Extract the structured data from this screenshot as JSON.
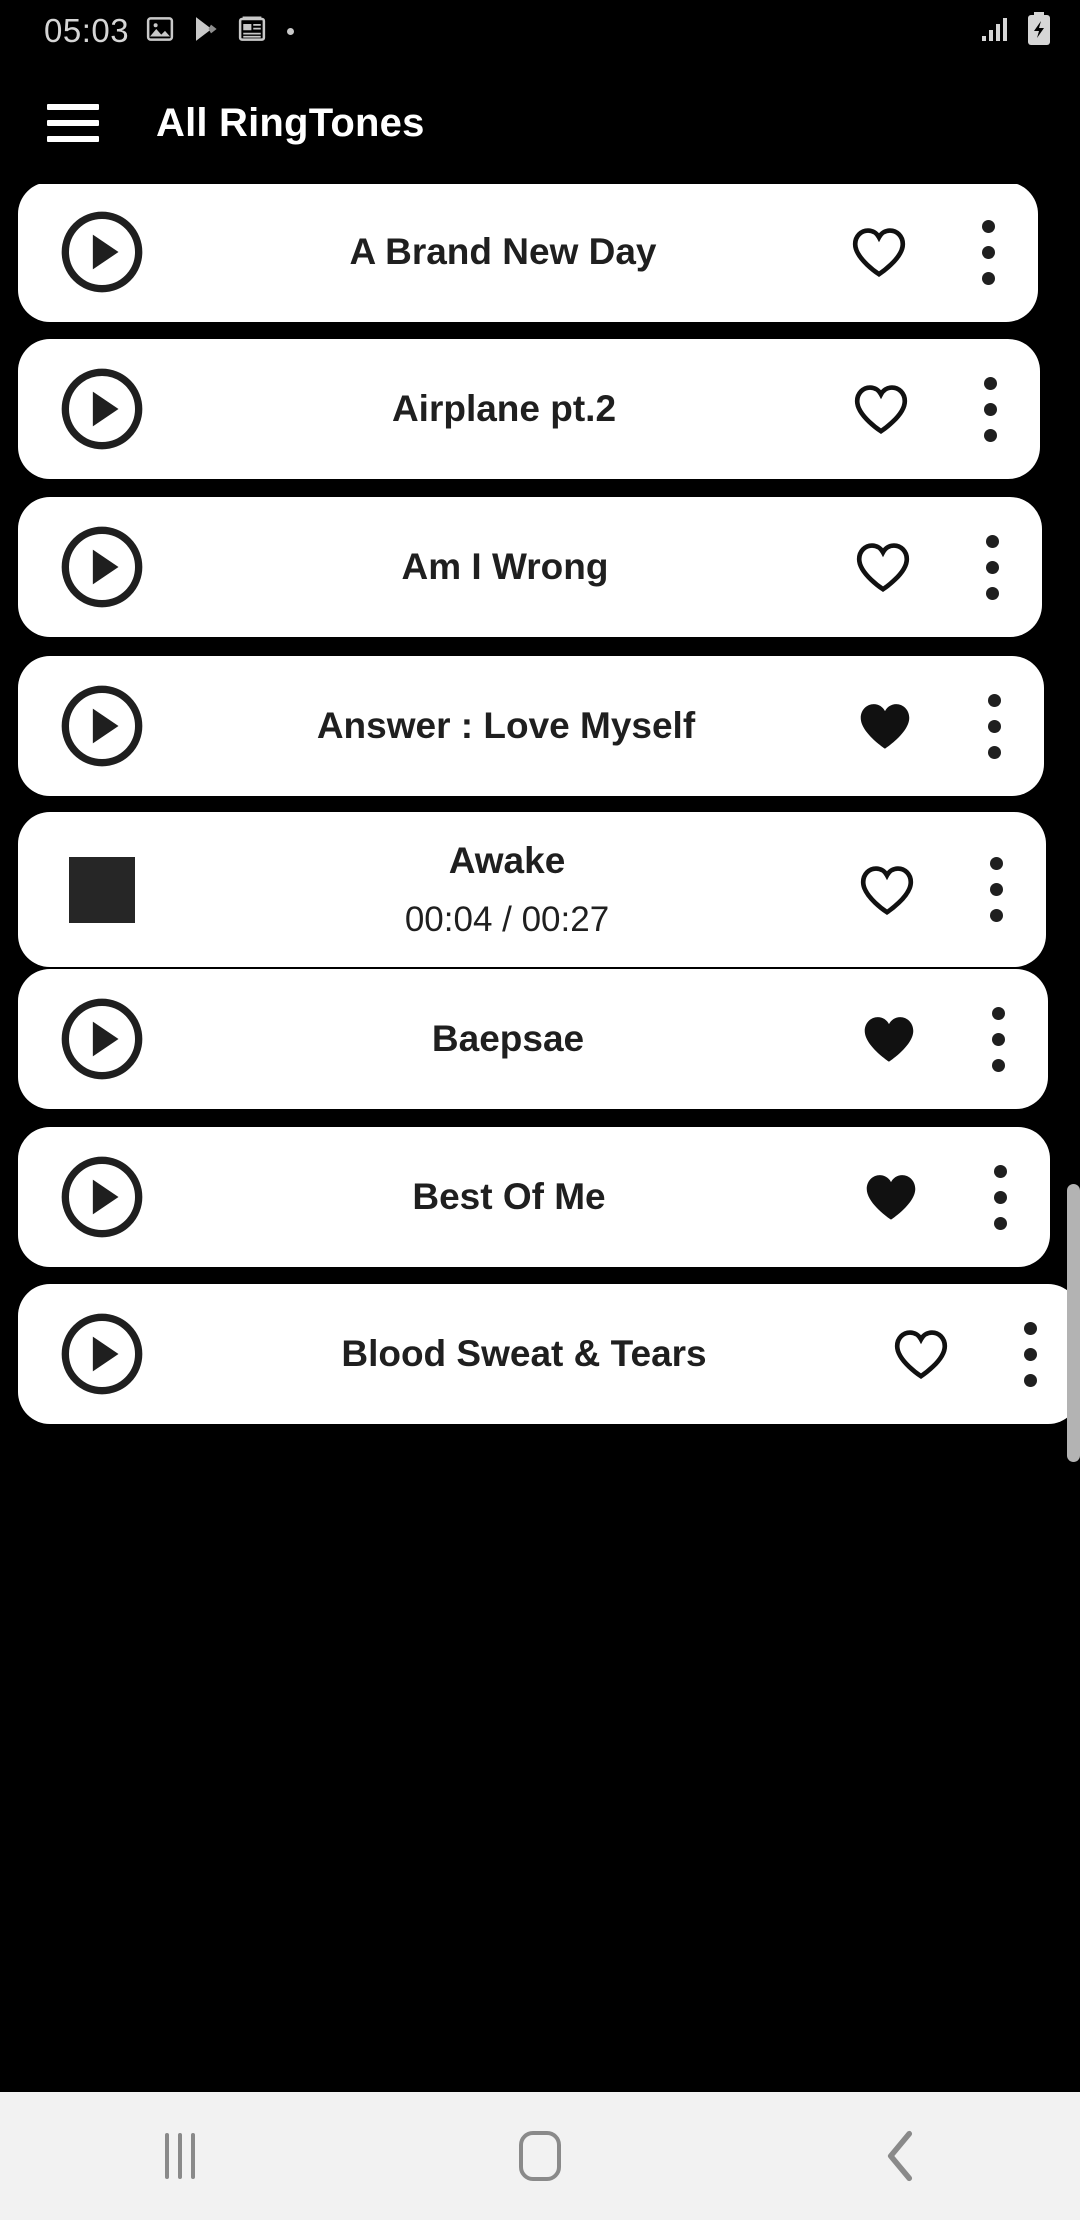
{
  "status_bar": {
    "clock": "05:03",
    "left_icons": [
      "image-icon",
      "play-store-icon",
      "news-icon",
      "more-dot-icon"
    ],
    "right_icons": [
      "signal-bars-icon",
      "battery-charging-icon"
    ]
  },
  "app_bar": {
    "menu_icon": "hamburger-menu-icon",
    "title": "All RingTones"
  },
  "colors": {
    "background": "#000000",
    "card": "#ffffff",
    "text": "#1f1f1f",
    "title": "#ffffff",
    "scrollbar": "#b3b3b3",
    "navbar": "#f2f2f2",
    "nav_glyph": "#8a8a8a"
  },
  "list": {
    "items": [
      {
        "title": "A Brand New Day",
        "state": "stopped",
        "play_icon": "play-circle-icon",
        "favorite": false,
        "favorite_icon": "heart-outline-icon",
        "menu_icon": "more-vertical-icon",
        "timer": ""
      },
      {
        "title": "Airplane pt.2",
        "state": "stopped",
        "play_icon": "play-circle-icon",
        "favorite": false,
        "favorite_icon": "heart-outline-icon",
        "menu_icon": "more-vertical-icon",
        "timer": ""
      },
      {
        "title": "Am I Wrong",
        "state": "stopped",
        "play_icon": "play-circle-icon",
        "favorite": false,
        "favorite_icon": "heart-outline-icon",
        "menu_icon": "more-vertical-icon",
        "timer": ""
      },
      {
        "title": "Answer : Love Myself",
        "state": "stopped",
        "play_icon": "play-circle-icon",
        "favorite": true,
        "favorite_icon": "heart-filled-icon",
        "menu_icon": "more-vertical-icon",
        "timer": ""
      },
      {
        "title": "Awake",
        "state": "playing",
        "play_icon": "stop-square-icon",
        "favorite": false,
        "favorite_icon": "heart-outline-icon",
        "menu_icon": "more-vertical-icon",
        "timer": "00:04 / 00:27"
      },
      {
        "title": "Baepsae",
        "state": "stopped",
        "play_icon": "play-circle-icon",
        "favorite": true,
        "favorite_icon": "heart-filled-icon",
        "menu_icon": "more-vertical-icon",
        "timer": ""
      },
      {
        "title": "Best Of Me",
        "state": "stopped",
        "play_icon": "play-circle-icon",
        "favorite": true,
        "favorite_icon": "heart-filled-icon",
        "menu_icon": "more-vertical-icon",
        "timer": ""
      },
      {
        "title": "Blood Sweat & Tears",
        "state": "stopped",
        "play_icon": "play-circle-icon",
        "favorite": false,
        "favorite_icon": "heart-outline-icon",
        "menu_icon": "more-vertical-icon",
        "timer": ""
      }
    ]
  },
  "nav_bar": {
    "buttons": [
      {
        "name": "recents-button",
        "icon": "recents-icon"
      },
      {
        "name": "home-button",
        "icon": "home-icon"
      },
      {
        "name": "back-button",
        "icon": "back-chevron-icon"
      }
    ]
  }
}
